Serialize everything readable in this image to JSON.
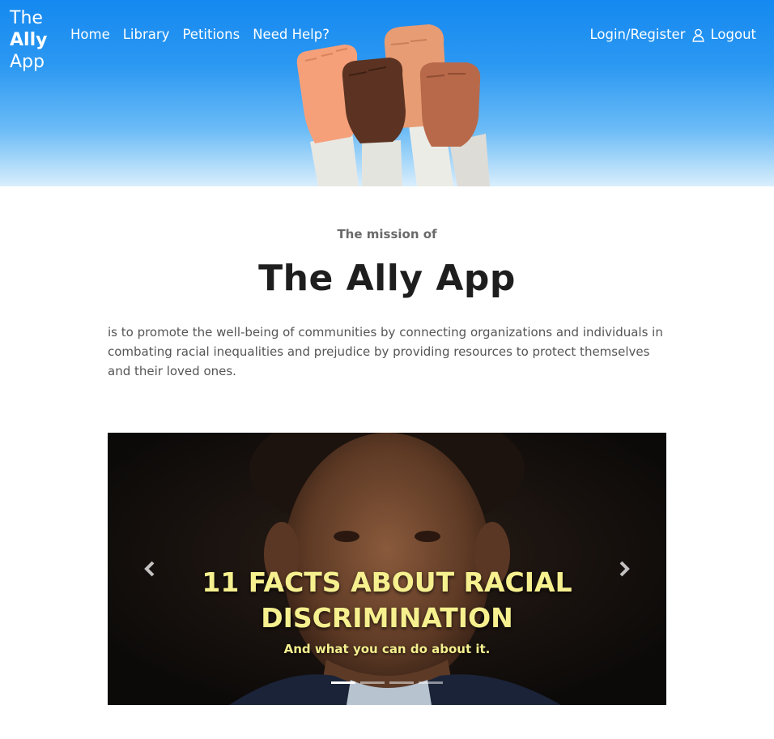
{
  "brand": {
    "line1": "The",
    "line2": "Ally",
    "line3": "App"
  },
  "nav": {
    "items": [
      "Home",
      "Library",
      "Petitions",
      "Need Help?"
    ],
    "login_label": "Login/Register",
    "logout_label": "Logout",
    "user_icon": "user-icon"
  },
  "mission": {
    "eyebrow": "The mission of",
    "title": "The Ally App",
    "description": "is to promote the well-being of communities by connecting organizations and individuals in combating racial inequalities and prejudice by providing resources to protect themselves and their loved ones."
  },
  "carousel": {
    "headline_line1": "11 FACTS ABOUT RACIAL",
    "headline_line2": "DISCRIMINATION",
    "subline": "And what you can do about it.",
    "prev_icon": "chevron-left-icon",
    "next_icon": "chevron-right-icon",
    "slide_count": 4,
    "active_index": 0
  },
  "colors": {
    "hero_top": "#1589f0",
    "hero_bottom": "#d9eefc",
    "headline": "#f6f08f",
    "title": "#1e1e1e"
  }
}
